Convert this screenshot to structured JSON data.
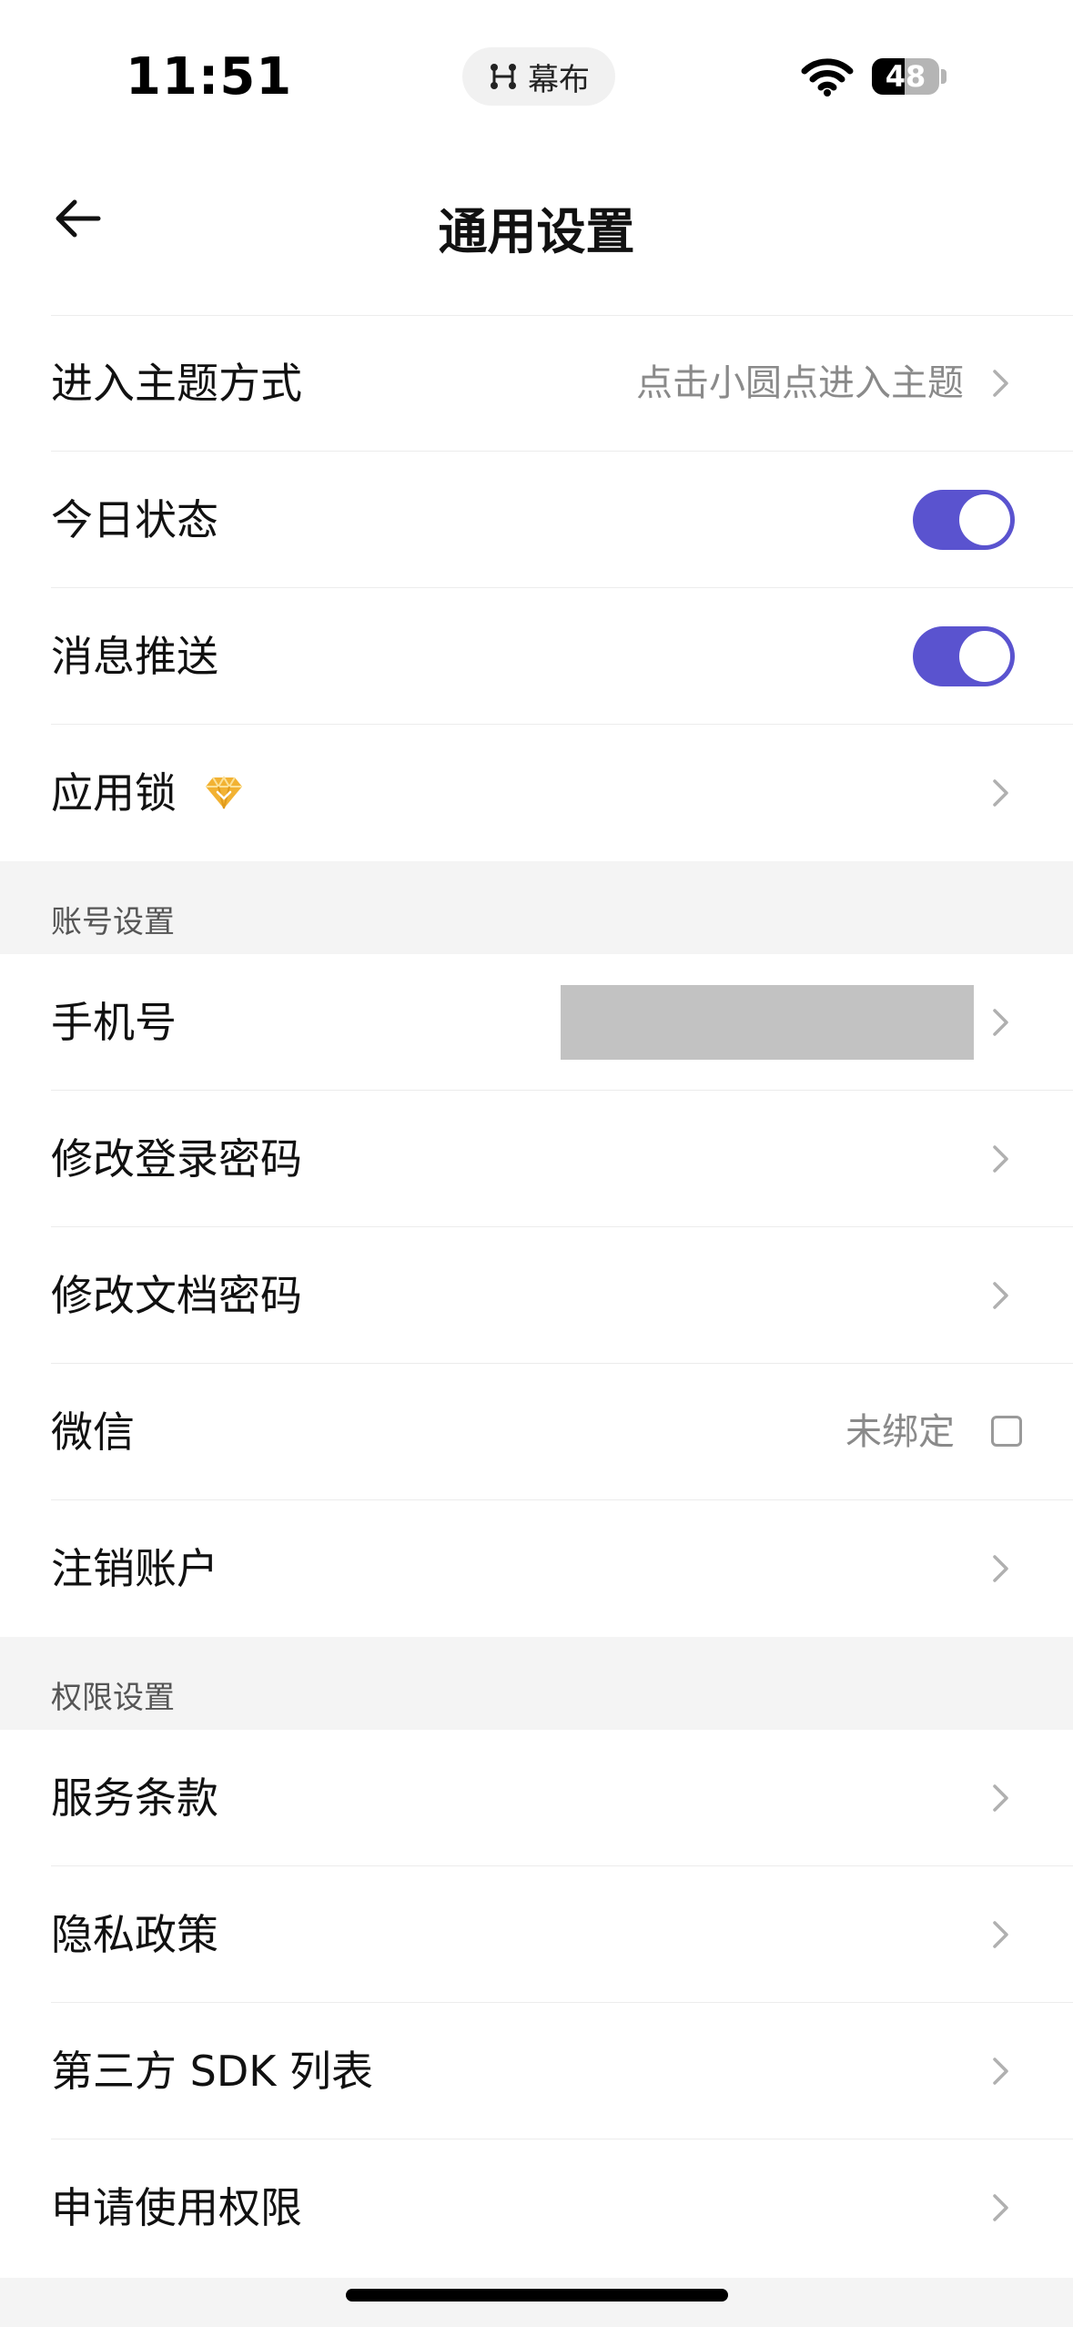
{
  "status_bar": {
    "time": "11:51",
    "app_pill_label": "幕布",
    "battery_level": "48",
    "battery_fraction": 0.48
  },
  "header": {
    "title": "通用设置"
  },
  "general": {
    "rows": [
      {
        "label": "进入主题方式",
        "value": "点击小圆点进入主题"
      },
      {
        "label": "今日状态",
        "toggle_on": true
      },
      {
        "label": "消息推送",
        "toggle_on": true
      },
      {
        "label": "应用锁"
      }
    ]
  },
  "account": {
    "header": "账号设置",
    "rows": [
      {
        "label": "手机号"
      },
      {
        "label": "修改登录密码"
      },
      {
        "label": "修改文档密码"
      },
      {
        "label": "微信",
        "value": "未绑定"
      },
      {
        "label": "注销账户"
      }
    ]
  },
  "permissions": {
    "header": "权限设置",
    "rows": [
      {
        "label": "服务条款"
      },
      {
        "label": "隐私政策"
      },
      {
        "label": "第三方 SDK 列表"
      },
      {
        "label": "申请使用权限"
      }
    ]
  },
  "icons": {
    "back": "arrow-left-icon",
    "chevron": "chevron-right-icon",
    "wifi": "wifi-icon",
    "gem": "diamond-icon",
    "app_pill": "mindmap-icon"
  },
  "colors": {
    "accent": "#5a53cf",
    "gem": "#f2b233",
    "section_background": "#f4f4f4",
    "secondary_text": "#8a8a8a"
  }
}
